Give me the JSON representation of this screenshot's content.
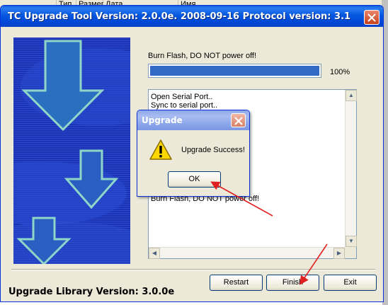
{
  "background": {
    "columns": [
      "Тип",
      "Размер",
      "Дата",
      "Имя"
    ]
  },
  "window": {
    "title": "TC Upgrade Tool Version: 2.0.0e. 2008-09-16 Protocol version: 3.1",
    "status_text": "Burn Flash, DO NOT power off!",
    "progress_percent": 100,
    "progress_label": "100%",
    "log_lines": [
      "Open Serial Port..",
      "Sync to serial port..",
      "Burn Flash, DO NOT power off!"
    ],
    "library_version": "Upgrade Library Version: 3.0.0e",
    "buttons": {
      "restart": "Restart",
      "finish": "Finish",
      "exit": "Exit"
    }
  },
  "dialog": {
    "title": "Upgrade",
    "message": "Upgrade Success!",
    "ok_label": "OK"
  },
  "icons": [
    "close-icon",
    "warning-icon",
    "down-arrow-icon"
  ],
  "colors": {
    "titlebar": "#0558e0",
    "dialog_titlebar": "#8aa5ea",
    "progress_fill": "#316ac5",
    "annotation_arrow": "#e02020"
  }
}
